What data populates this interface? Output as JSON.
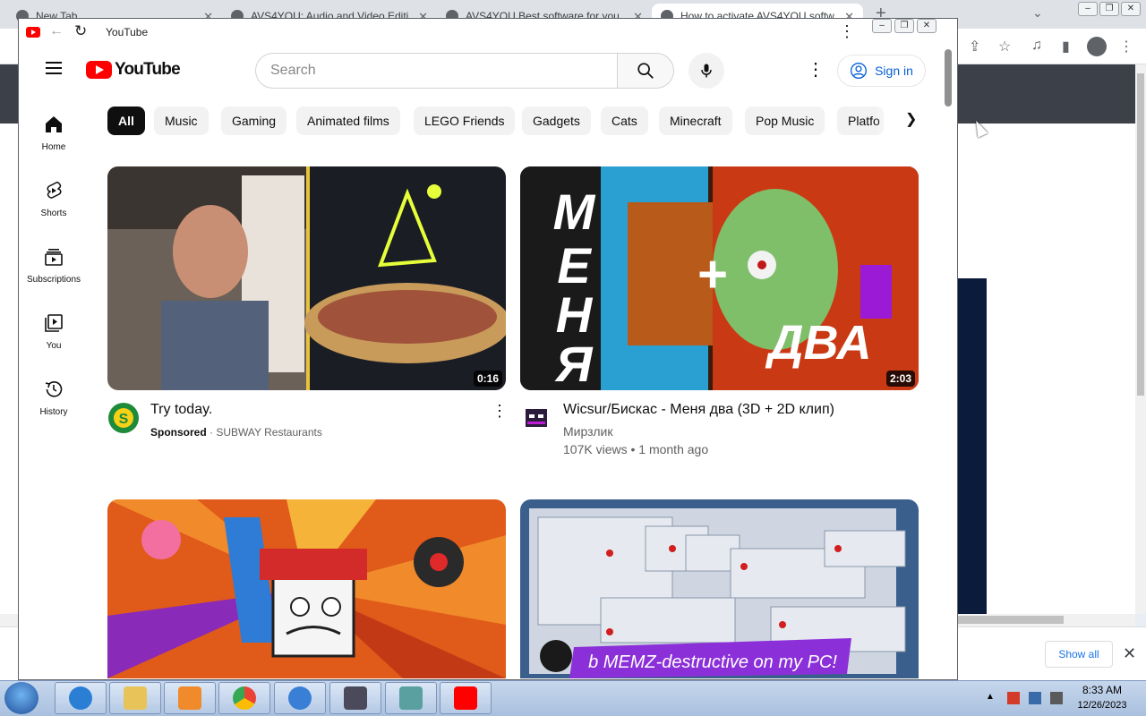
{
  "chrome": {
    "tabs": [
      {
        "label": "New Tab"
      },
      {
        "label": "AVS4YOU: Audio and Video Editi"
      },
      {
        "label": "AVS4YOU Best software for you"
      },
      {
        "label": "How to activate AVS4YOU softw"
      }
    ],
    "new_tab": "+",
    "download_bar": {
      "show_all": "Show all"
    }
  },
  "yt_window": {
    "title": "YouTube",
    "search": {
      "placeholder": "Search"
    },
    "sign_in": "Sign in",
    "guide": [
      {
        "label": "Home"
      },
      {
        "label": "Shorts"
      },
      {
        "label": "Subscriptions"
      },
      {
        "label": "You"
      },
      {
        "label": "History"
      }
    ],
    "chips": [
      "All",
      "Music",
      "Gaming",
      "Animated films",
      "LEGO Friends",
      "Gadgets",
      "Cats",
      "Minecraft",
      "Pop Music",
      "Platfo"
    ],
    "videos": [
      {
        "title": "Try today.",
        "sponsored": "Sponsored",
        "channel": "· SUBWAY Restaurants",
        "duration": "0:16"
      },
      {
        "title": "Wicsur/Бискас - Меня два (3D + 2D клип)",
        "channel": "Мирзлик",
        "meta": "107K views • 1 month ago",
        "duration": "2:03"
      },
      {
        "title": "",
        "duration": ""
      },
      {
        "title": "",
        "thumb_text": "b MEMZ-destructive on my PC!"
      }
    ]
  },
  "thumb_text": {
    "menya": "МЕНЯ",
    "dva": "ДВА"
  },
  "taskbar": {
    "time": "8:33 AM",
    "date": "12/26/2023"
  },
  "colors": {
    "brand_red": "#FF0000",
    "link_blue": "#065FD4",
    "chip_active": "#0F0F0F"
  }
}
